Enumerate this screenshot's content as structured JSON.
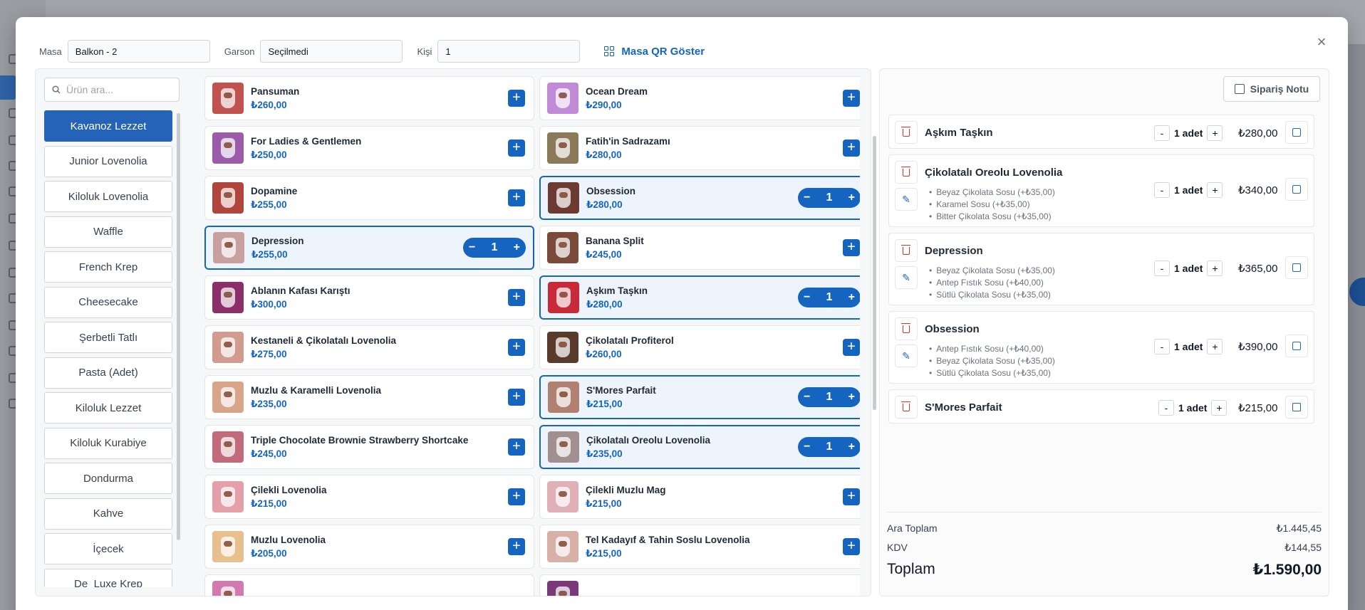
{
  "topbar": {
    "masa_label": "Masa",
    "masa_value": "Balkon - 2",
    "garson_label": "Garson",
    "garson_value": "Seçilmedi",
    "kisi_label": "Kişi",
    "kisi_value": "1",
    "qr_label": "Masa QR Göster"
  },
  "search": {
    "placeholder": "Ürün ara..."
  },
  "categories": [
    {
      "label": "Kavanoz Lezzet",
      "active": true
    },
    {
      "label": "Junior Lovenolia"
    },
    {
      "label": "Kiloluk Lovenolia"
    },
    {
      "label": "Waffle"
    },
    {
      "label": "French Krep"
    },
    {
      "label": "Cheesecake"
    },
    {
      "label": "Şerbetli Tatlı"
    },
    {
      "label": "Pasta (Adet)"
    },
    {
      "label": "Kiloluk Lezzet"
    },
    {
      "label": "Kiloluk Kurabiye"
    },
    {
      "label": "Dondurma"
    },
    {
      "label": "Kahve"
    },
    {
      "label": "İçecek"
    },
    {
      "label": "De_Luxe Krep"
    }
  ],
  "products": [
    {
      "name": "Pansuman",
      "price": "₺260,00",
      "color": "#c0524f"
    },
    {
      "name": "Ocean Dream",
      "price": "₺290,00",
      "color": "#c08ad6"
    },
    {
      "name": "For Ladies & Gentlemen",
      "price": "₺250,00",
      "color": "#9a5ba8"
    },
    {
      "name": "Fatih'in Sadrazamı",
      "price": "₺280,00",
      "color": "#8a7a5a"
    },
    {
      "name": "Dopamine",
      "price": "₺255,00",
      "color": "#b0453d"
    },
    {
      "name": "Obsession",
      "price": "₺280,00",
      "color": "#6b3a30",
      "qty": "1"
    },
    {
      "name": "Depression",
      "price": "₺255,00",
      "color": "#c9a0a0",
      "qty": "1"
    },
    {
      "name": "Banana Split",
      "price": "₺245,00",
      "color": "#7a4a3a"
    },
    {
      "name": "Ablanın Kafası Karıştı",
      "price": "₺300,00",
      "color": "#8a2f6a"
    },
    {
      "name": "Aşkım Taşkın",
      "price": "₺280,00",
      "color": "#c82a3a",
      "qty": "1"
    },
    {
      "name": "Kestaneli & Çikolatalı Lovenolia",
      "price": "₺275,00",
      "color": "#d29b8f"
    },
    {
      "name": "Çikolatalı Profiterol",
      "price": "₺260,00",
      "color": "#5a3a2a"
    },
    {
      "name": "Muzlu & Karamelli Lovenolia",
      "price": "₺235,00",
      "color": "#d7a58a"
    },
    {
      "name": "S'Mores Parfait",
      "price": "₺215,00",
      "color": "#b08070",
      "qty": "1"
    },
    {
      "name": "Triple Chocolate Brownie Strawberry Shortcake",
      "price": "₺245,00",
      "color": "#c06a7a"
    },
    {
      "name": "Çikolatalı Oreolu Lovenolia",
      "price": "₺235,00",
      "color": "#a09090",
      "qty": "1"
    },
    {
      "name": "Çilekli Lovenolia",
      "price": "₺215,00",
      "color": "#e3a0a8"
    },
    {
      "name": "Çilekli Muzlu Mag",
      "price": "₺215,00",
      "color": "#e0b0b8"
    },
    {
      "name": "Muzlu Lovenolia",
      "price": "₺205,00",
      "color": "#e8c090"
    },
    {
      "name": "Tel Kadayıf & Tahin Soslu Lovenolia",
      "price": "₺215,00",
      "color": "#d8b0a8"
    },
    {
      "name": "",
      "price": "",
      "color": "#d07ab0"
    },
    {
      "name": "",
      "price": "",
      "color": "#7a3a7a"
    }
  ],
  "order": {
    "note_label": "Sipariş Notu",
    "items": [
      {
        "name": "Aşkım Taşkın",
        "qty": "1 adet",
        "price": "₺280,00",
        "options": []
      },
      {
        "name": "Çikolatalı Oreolu Lovenolia",
        "qty": "1 adet",
        "price": "₺340,00",
        "options": [
          "Beyaz Çikolata Sosu (+₺35,00)",
          "Karamel Sosu (+₺35,00)",
          "Bitter Çikolata Sosu (+₺35,00)"
        ]
      },
      {
        "name": "Depression",
        "qty": "1 adet",
        "price": "₺365,00",
        "options": [
          "Beyaz Çikolata Sosu (+₺35,00)",
          "Antep Fıstık Sosu (+₺40,00)",
          "Sütlü Çikolata Sosu (+₺35,00)"
        ]
      },
      {
        "name": "Obsession",
        "qty": "1 adet",
        "price": "₺390,00",
        "options": [
          "Antep Fıstık Sosu (+₺40,00)",
          "Beyaz Çikolata Sosu (+₺35,00)",
          "Sütlü Çikolata Sosu (+₺35,00)"
        ]
      },
      {
        "name": "S'Mores Parfait",
        "qty": "1 adet",
        "price": "₺215,00",
        "options": []
      }
    ]
  },
  "totals": {
    "subtotal_label": "Ara Toplam",
    "subtotal": "₺1.445,45",
    "tax_label": "KDV",
    "tax": "₺144,55",
    "total_label": "Toplam",
    "total": "₺1.590,00"
  },
  "colors": {
    "accent": "#1565c0",
    "danger": "#d9342b"
  }
}
